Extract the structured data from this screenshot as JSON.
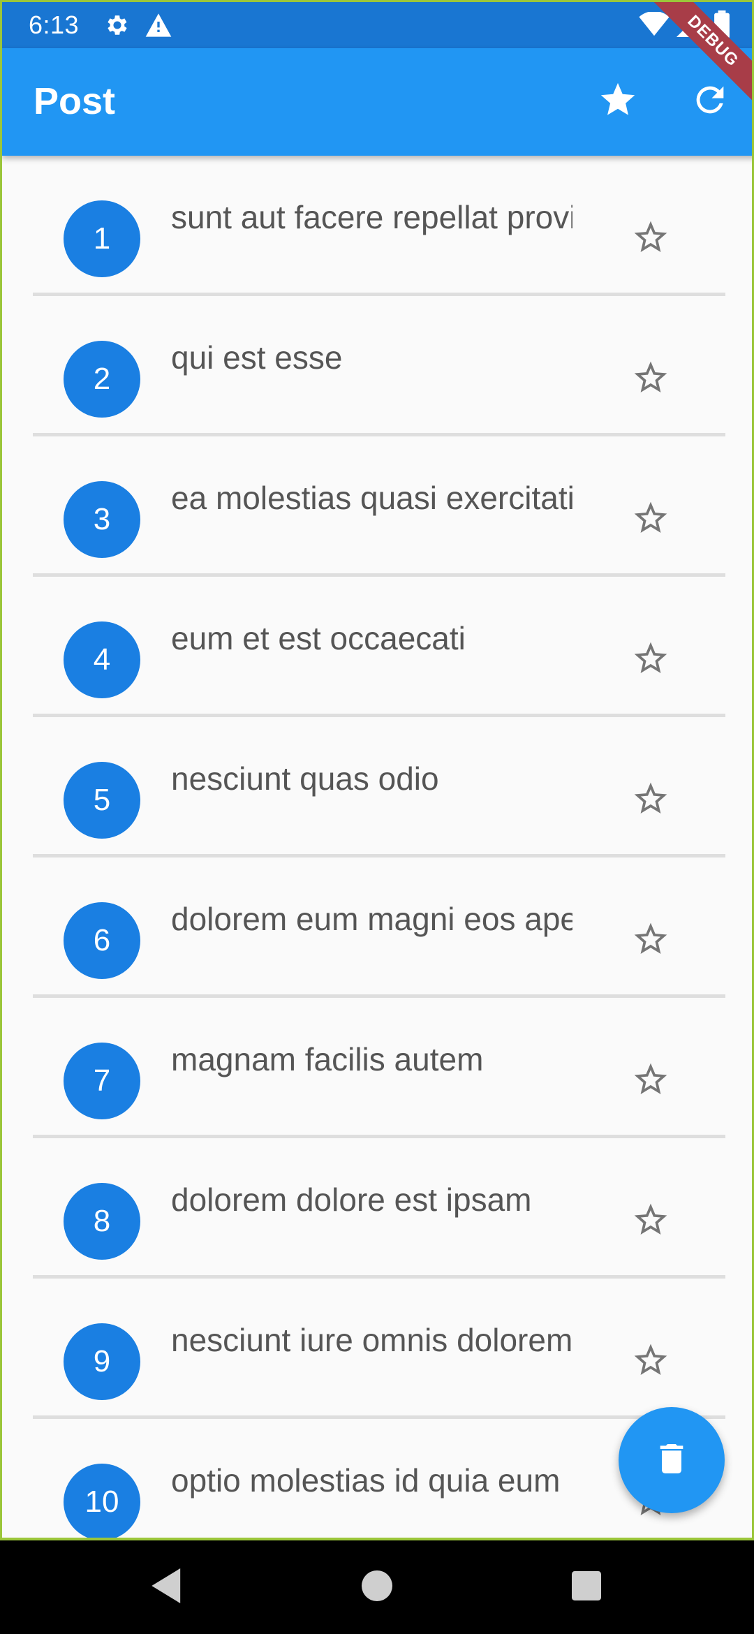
{
  "status_bar": {
    "time": "6:13",
    "icons": [
      "gear-icon",
      "warning-icon",
      "wifi-icon",
      "signal-icon",
      "battery-icon"
    ]
  },
  "debug_banner": "DEBUG",
  "app_bar": {
    "title": "Post",
    "actions": [
      "star-icon",
      "refresh-icon"
    ],
    "background": "#2196f3"
  },
  "posts": [
    {
      "id": "1",
      "title": "sunt aut facere repellat provident",
      "favorite_icon": "star-outline-icon"
    },
    {
      "id": "2",
      "title": "qui est esse",
      "favorite_icon": "star-outline-icon"
    },
    {
      "id": "3",
      "title": "ea molestias quasi exercitationem",
      "favorite_icon": "star-outline-icon"
    },
    {
      "id": "4",
      "title": "eum et est occaecati",
      "favorite_icon": "star-outline-icon"
    },
    {
      "id": "5",
      "title": "nesciunt quas odio",
      "favorite_icon": "star-outline-icon"
    },
    {
      "id": "6",
      "title": "dolorem eum magni eos aperiam",
      "favorite_icon": "star-outline-icon"
    },
    {
      "id": "7",
      "title": "magnam facilis autem",
      "favorite_icon": "star-outline-icon"
    },
    {
      "id": "8",
      "title": "dolorem dolore est ipsam",
      "favorite_icon": "star-outline-icon"
    },
    {
      "id": "9",
      "title": "nesciunt iure omnis dolorem",
      "favorite_icon": "star-outline-icon"
    },
    {
      "id": "10",
      "title": "optio molestias id quia eum",
      "favorite_icon": "star-outline-icon"
    }
  ],
  "fab": {
    "icon": "trash-icon"
  },
  "nav_bar": {
    "buttons": [
      "back-icon",
      "home-icon",
      "recents-icon"
    ]
  },
  "colors": {
    "accent": "#2196f3",
    "avatar": "#1a7fe2",
    "status_bar": "#1976d2"
  }
}
